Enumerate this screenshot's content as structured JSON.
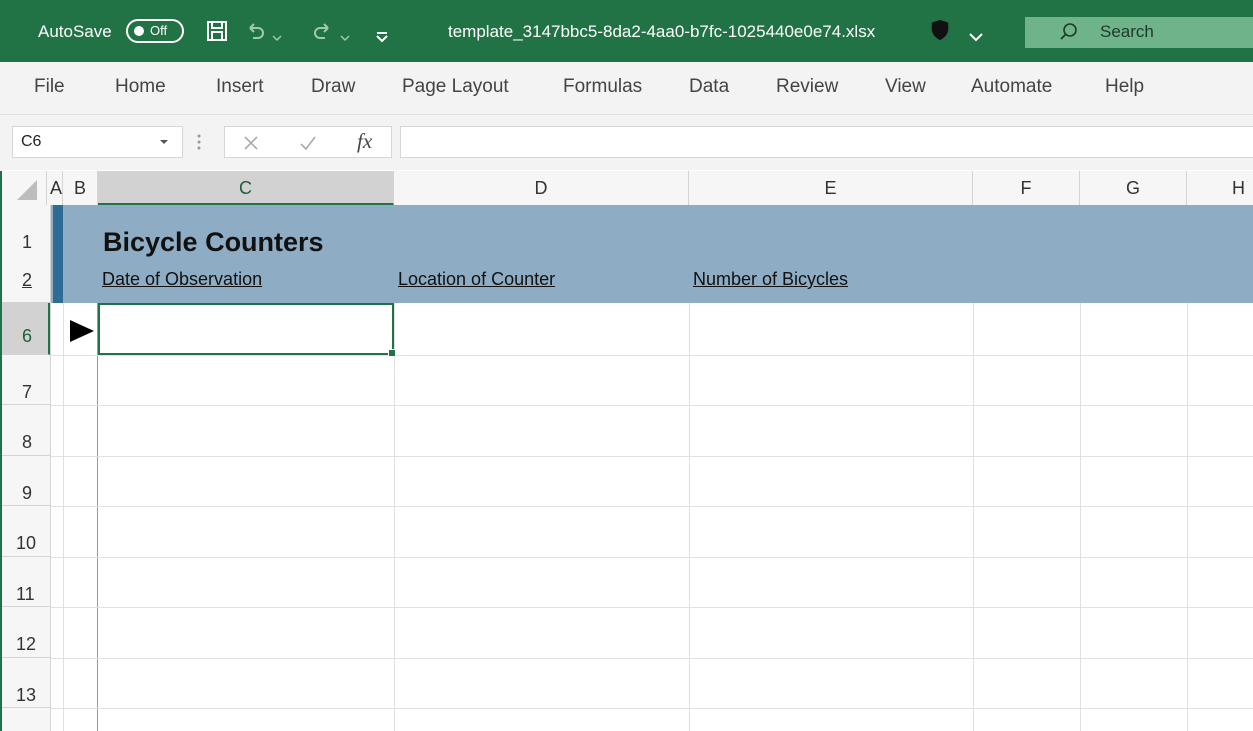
{
  "titlebar": {
    "autosave_label": "AutoSave",
    "autosave_state": "Off",
    "filename": "template_3147bbc5-8da2-4aa0-b7fc-1025440e0e74.xlsx",
    "search_label": "Search",
    "accent": "#217346"
  },
  "menu": {
    "items": [
      "File",
      "Home",
      "Insert",
      "Draw",
      "Page Layout",
      "Formulas",
      "Data",
      "Review",
      "View",
      "Automate",
      "Help"
    ]
  },
  "formula_bar": {
    "name_box": "C6",
    "fx_label": "fx",
    "formula_value": ""
  },
  "grid": {
    "columns": [
      "A",
      "B",
      "C",
      "D",
      "E",
      "F",
      "G",
      "H"
    ],
    "selected_column": "C",
    "rows": [
      "1",
      "2",
      "6",
      "7",
      "8",
      "9",
      "10",
      "11",
      "12",
      "13"
    ],
    "selected_row": "6",
    "active_cell": "C6"
  },
  "sheet": {
    "title": "Bicycle Counters",
    "header_c": "Date of Observation",
    "header_d": "Location of Counter",
    "header_e": "Number of Bicycles",
    "banner_color": "#8eadc4",
    "strip_color": "#2e6b95"
  }
}
